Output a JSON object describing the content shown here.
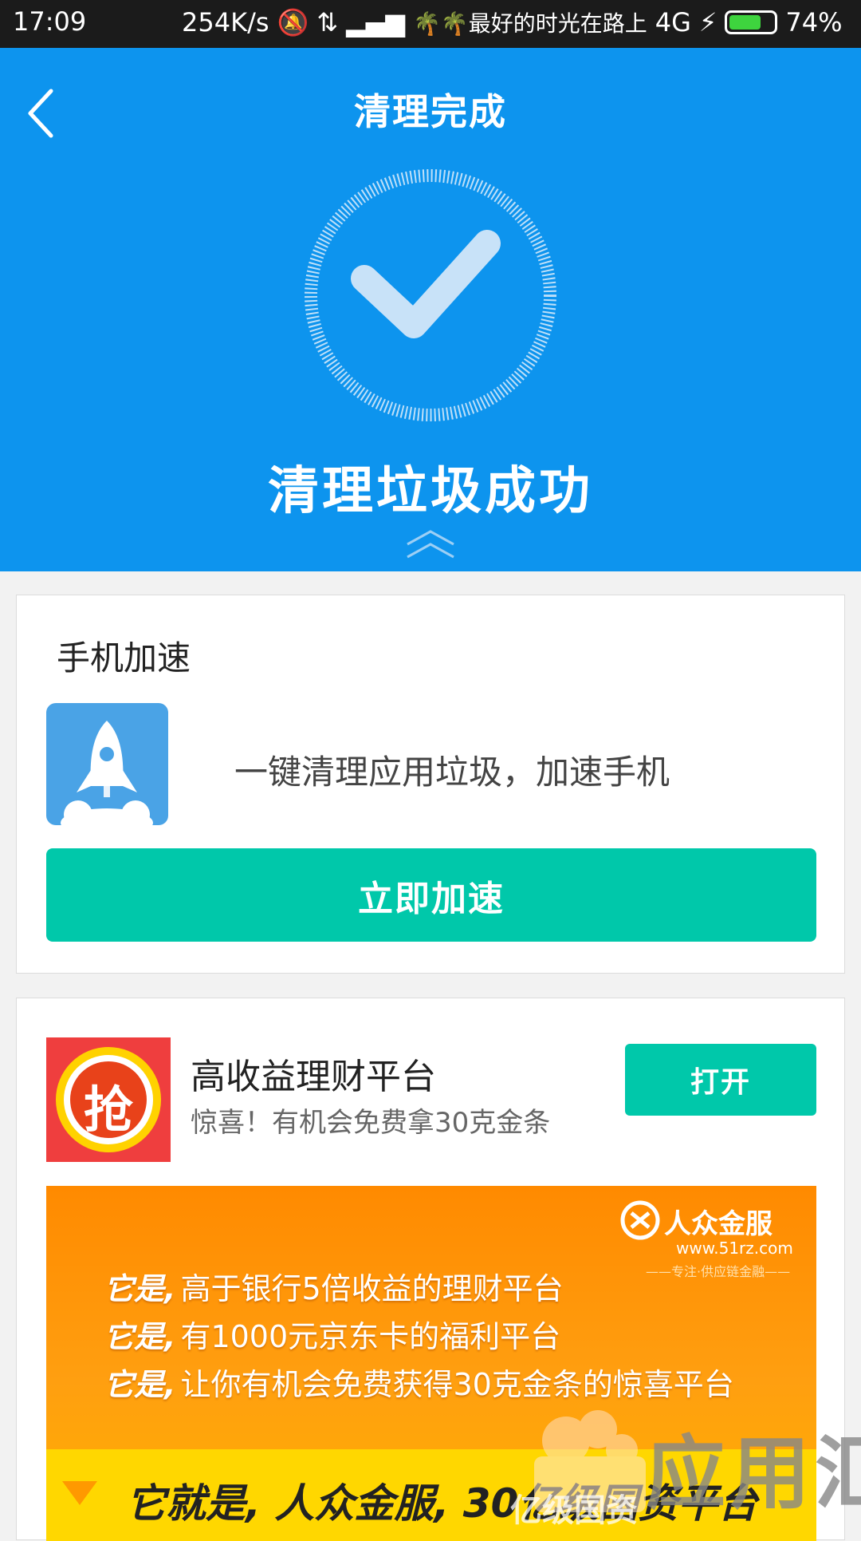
{
  "status_bar": {
    "time": "17:09",
    "speed": "254K/s",
    "carrier": "🌴🌴最好的时光在路上",
    "network": "4G",
    "battery": "74%",
    "battery_level": 0.74
  },
  "header": {
    "title": "清理完成",
    "result": "清理垃圾成功",
    "back_icon": "chevron-left-icon",
    "collapse_icon": "double-chevron-up-icon"
  },
  "speed_card": {
    "heading": "手机加速",
    "description": "一键清理应用垃圾，加速手机",
    "button_label": "立即加速",
    "icon": "rocket-icon"
  },
  "ad_card": {
    "logo_text": "抢",
    "title": "高收益理财平台",
    "subtitle": "惊喜！有机会免费拿30克金条",
    "open_label": "打开",
    "banner": {
      "brand": "人众金服",
      "url": "www.51rz.com",
      "slogan": "——专注·供应链金融——",
      "lines": [
        {
          "prefix": "它是,",
          "text": "高于银行5倍收益的理财平台"
        },
        {
          "prefix": "它是,",
          "text": "有1000元京东卡的福利平台"
        },
        {
          "prefix": "它是,",
          "text": "让你有机会免费获得30克金条的惊喜平台"
        }
      ],
      "bottom_text": "它就是, 人众金服, 30亿级国资平台"
    }
  },
  "watermark": {
    "text": "应用汇",
    "sub": "亿级国资"
  },
  "colors": {
    "header_blue": "#0d94ee",
    "accent_green": "#00c8aa",
    "banner_orange": "#ff9000"
  }
}
